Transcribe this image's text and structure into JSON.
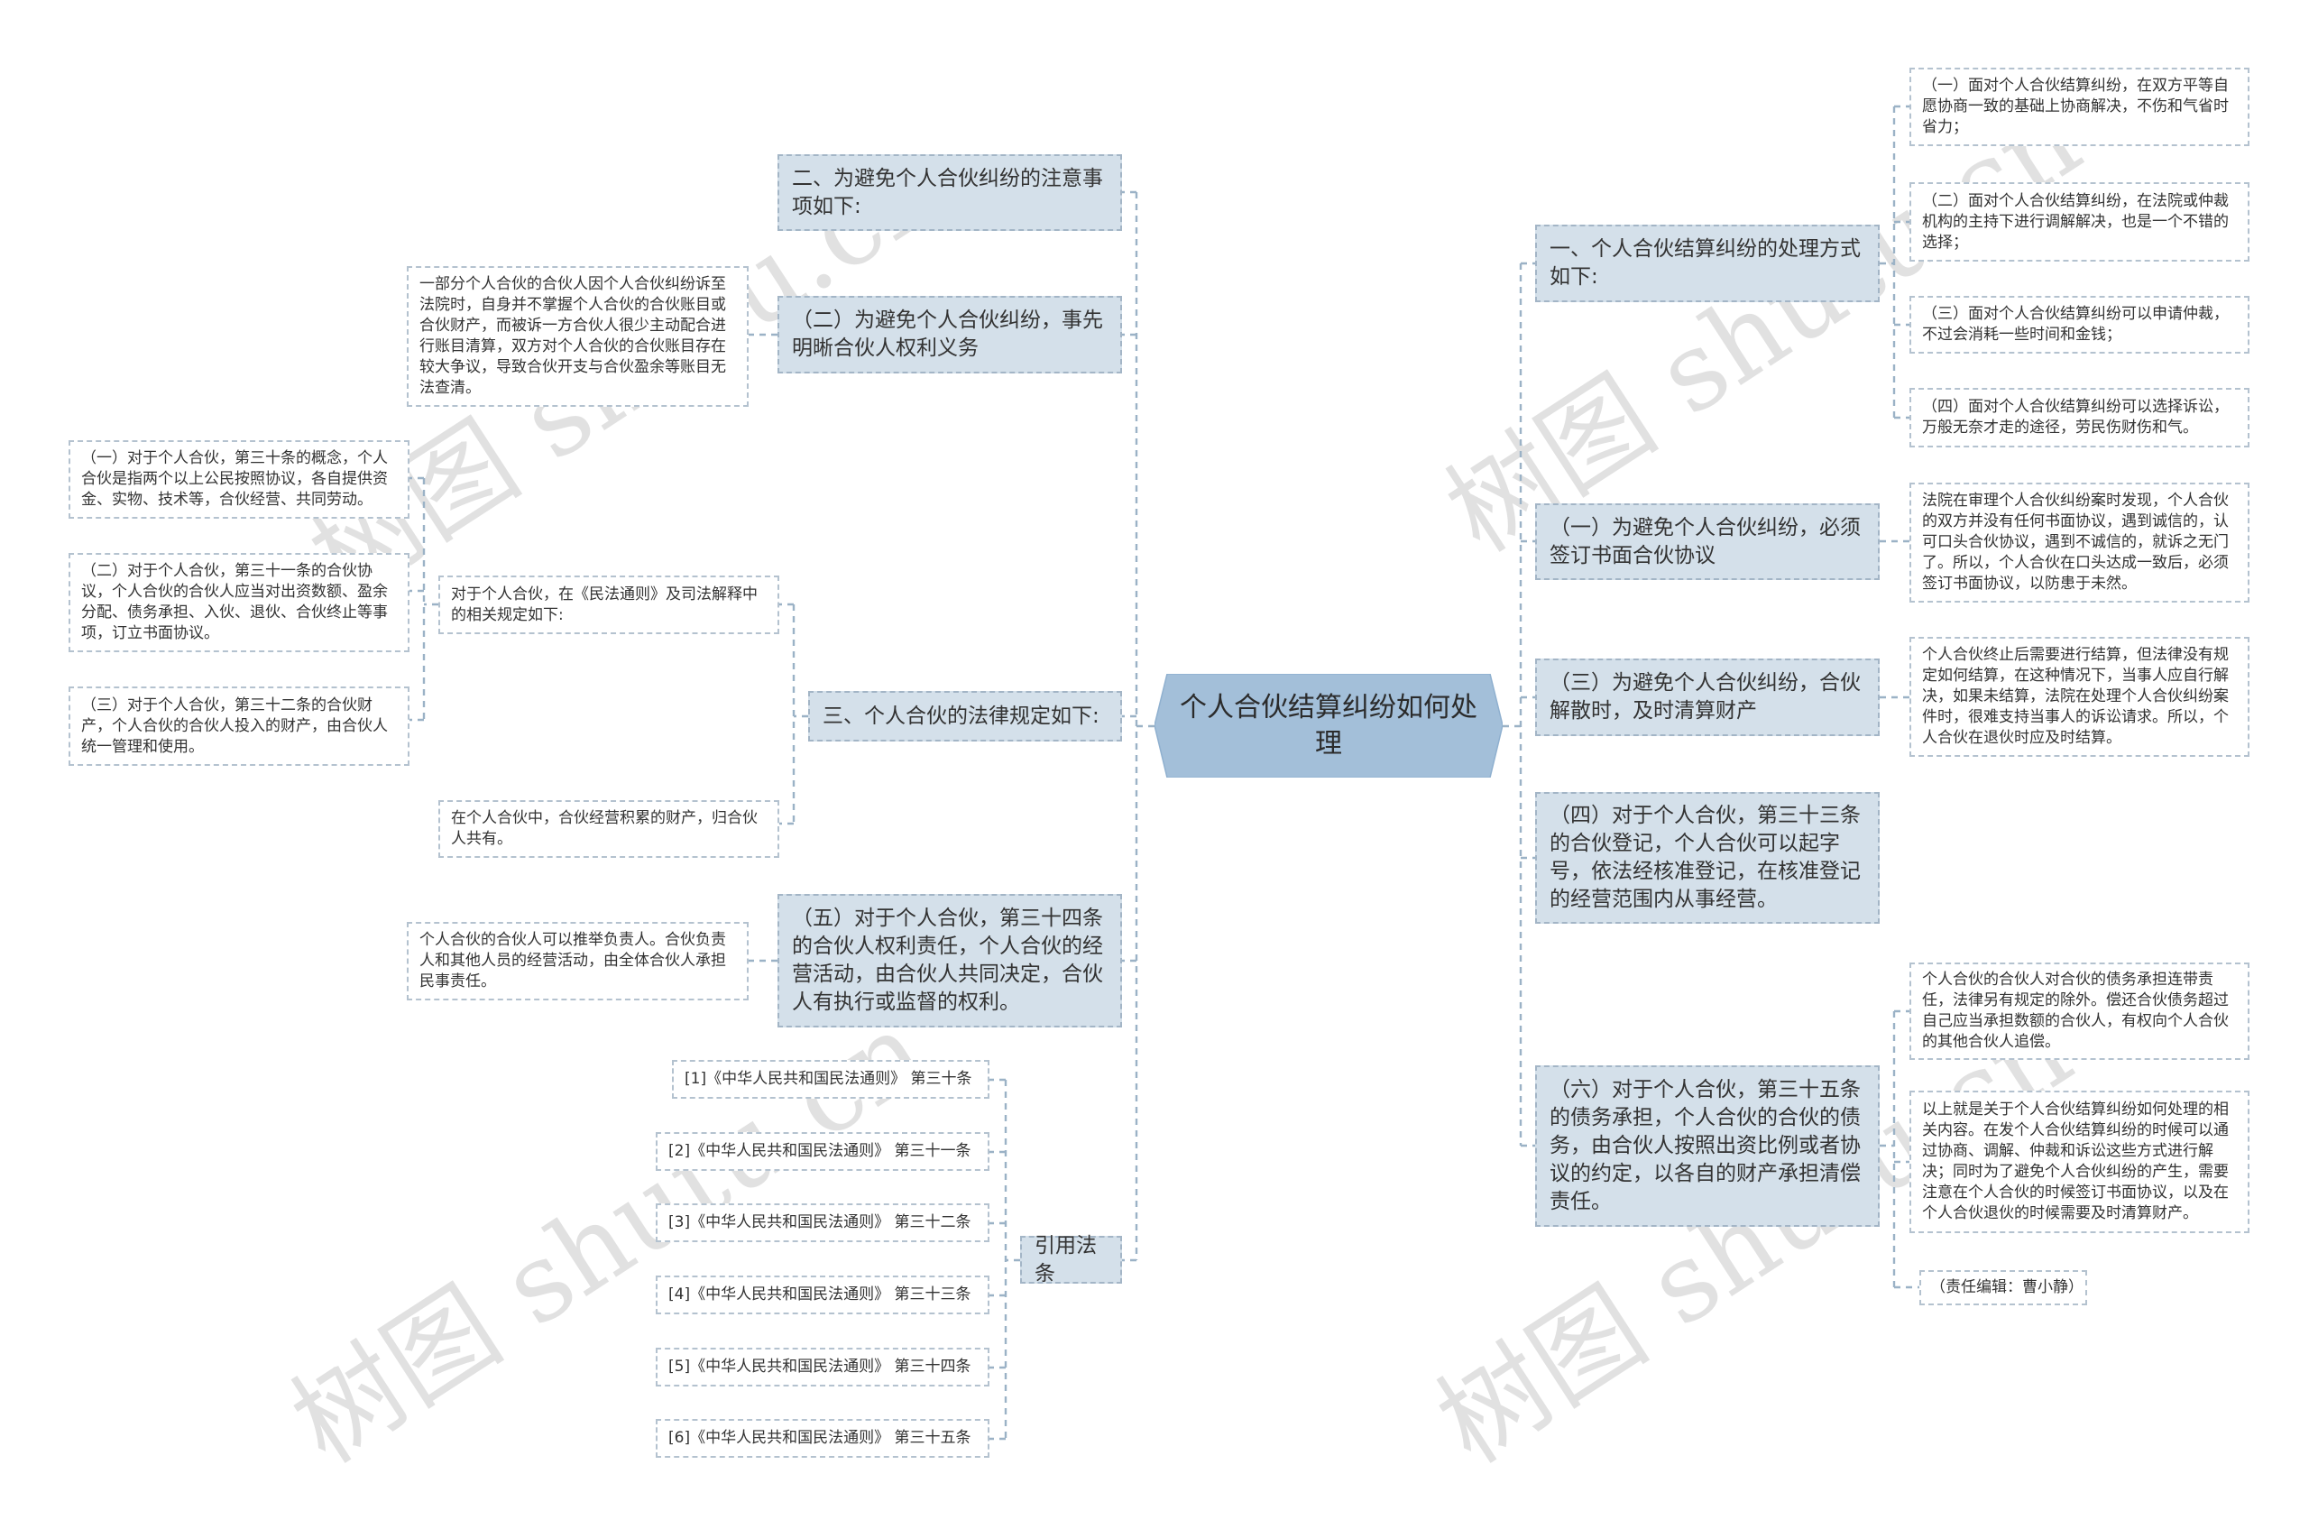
{
  "watermark": "树图 shutu.cn",
  "colors": {
    "root_fill": "#a3bfd9",
    "main_fill": "#d4e0ea",
    "leaf_fill": "#ffffff",
    "connector": "#9bb2c6"
  },
  "root": {
    "label": "个人合伙结算纠纷如何处理"
  },
  "right": [
    {
      "label": "一、个人合伙结算纠纷的处理方式如下:",
      "children": [
        "（一）面对个人合伙结算纠纷，在双方平等自愿协商一致的基础上协商解决，不伤和气省时省力；",
        "（二）面对个人合伙结算纠纷，在法院或仲裁机构的主持下进行调解解决，也是一个不错的选择；",
        "（三）面对个人合伙结算纠纷可以申请仲裁，不过会消耗一些时间和金钱；",
        "（四）面对个人合伙结算纠纷可以选择诉讼，万般无奈才走的途径，劳民伤财伤和气。"
      ]
    },
    {
      "label": "（一）为避免个人合伙纠纷，必须签订书面合伙协议",
      "children": [
        "法院在审理个人合伙纠纷案时发现，个人合伙的双方并没有任何书面协议，遇到诚信的，认可口头合伙协议，遇到不诚信的，就诉之无门了。所以，个人合伙在口头达成一致后，必须签订书面协议，以防患于未然。"
      ]
    },
    {
      "label": "（三）为避免个人合伙纠纷，合伙解散时，及时清算财产",
      "children": [
        "个人合伙终止后需要进行结算，但法律没有规定如何结算，在这种情况下，当事人应自行解决，如果未结算，法院在处理个人合伙纠纷案件时，很难支持当事人的诉讼请求。所以，个人合伙在退伙时应及时结算。"
      ]
    },
    {
      "label": "（四）对于个人合伙，第三十三条的合伙登记，个人合伙可以起字号，依法经核准登记，在核准登记的经营范围内从事经营。",
      "children": []
    },
    {
      "label": "（六）对于个人合伙，第三十五条的债务承担，个人合伙的合伙的债务，由合伙人按照出资比例或者协议的约定，以各自的财产承担清偿责任。",
      "children": [
        "个人合伙的合伙人对合伙的债务承担连带责任，法律另有规定的除外。偿还合伙债务超过自己应当承担数额的合伙人，有权向个人合伙的其他合伙人追偿。",
        "以上就是关于个人合伙结算纠纷如何处理的相关内容。在发个人合伙结算纠纷的时候可以通过协商、调解、仲裁和诉讼这些方式进行解决；同时为了避免个人合伙纠纷的产生，需要注意在个人合伙的时候签订书面协议，以及在个人合伙退伙的时候需要及时清算财产。",
        "（责任编辑：曹小静）"
      ]
    }
  ],
  "left": [
    {
      "label": "二、为避免个人合伙纠纷的注意事项如下:",
      "children": []
    },
    {
      "label": "（二）为避免个人合伙纠纷，事先明晰合伙人权利义务",
      "children": [
        "一部分个人合伙的合伙人因个人合伙纠纷诉至法院时，自身并不掌握个人合伙的合伙账目或合伙财产，而被诉一方合伙人很少主动配合进行账目清算，双方对个人合伙的合伙账目存在较大争议，导致合伙开支与合伙盈余等账目无法查清。"
      ]
    },
    {
      "label": "三、个人合伙的法律规定如下:",
      "children": [
        {
          "label": "对于个人合伙，在《民法通则》及司法解释中的相关规定如下:",
          "children": [
            "（一）对于个人合伙，第三十条的概念，个人合伙是指两个以上公民按照协议，各自提供资金、实物、技术等，合伙经营、共同劳动。",
            "（二）对于个人合伙，第三十一条的合伙协议，个人合伙的合伙人应当对出资数额、盈余分配、债务承担、入伙、退伙、合伙终止等事项，订立书面协议。",
            "（三）对于个人合伙，第三十二条的合伙财产，个人合伙的合伙人投入的财产，由合伙人统一管理和使用。"
          ]
        },
        {
          "label": "在个人合伙中，合伙经营积累的财产，归合伙人共有。",
          "children": []
        }
      ]
    },
    {
      "label": "（五）对于个人合伙，第三十四条的合伙人权利责任，个人合伙的经营活动，由合伙人共同决定，合伙人有执行或监督的权利。",
      "children": [
        "个人合伙的合伙人可以推举负责人。合伙负责人和其他人员的经营活动，由全体合伙人承担民事责任。"
      ]
    },
    {
      "label": "引用法条",
      "children": [
        "[1]《中华人民共和国民法通则》 第三十条",
        "[2]《中华人民共和国民法通则》 第三十一条",
        "[3]《中华人民共和国民法通则》 第三十二条",
        "[4]《中华人民共和国民法通则》 第三十三条",
        "[5]《中华人民共和国民法通则》 第三十四条",
        "[6]《中华人民共和国民法通则》 第三十五条"
      ]
    }
  ]
}
